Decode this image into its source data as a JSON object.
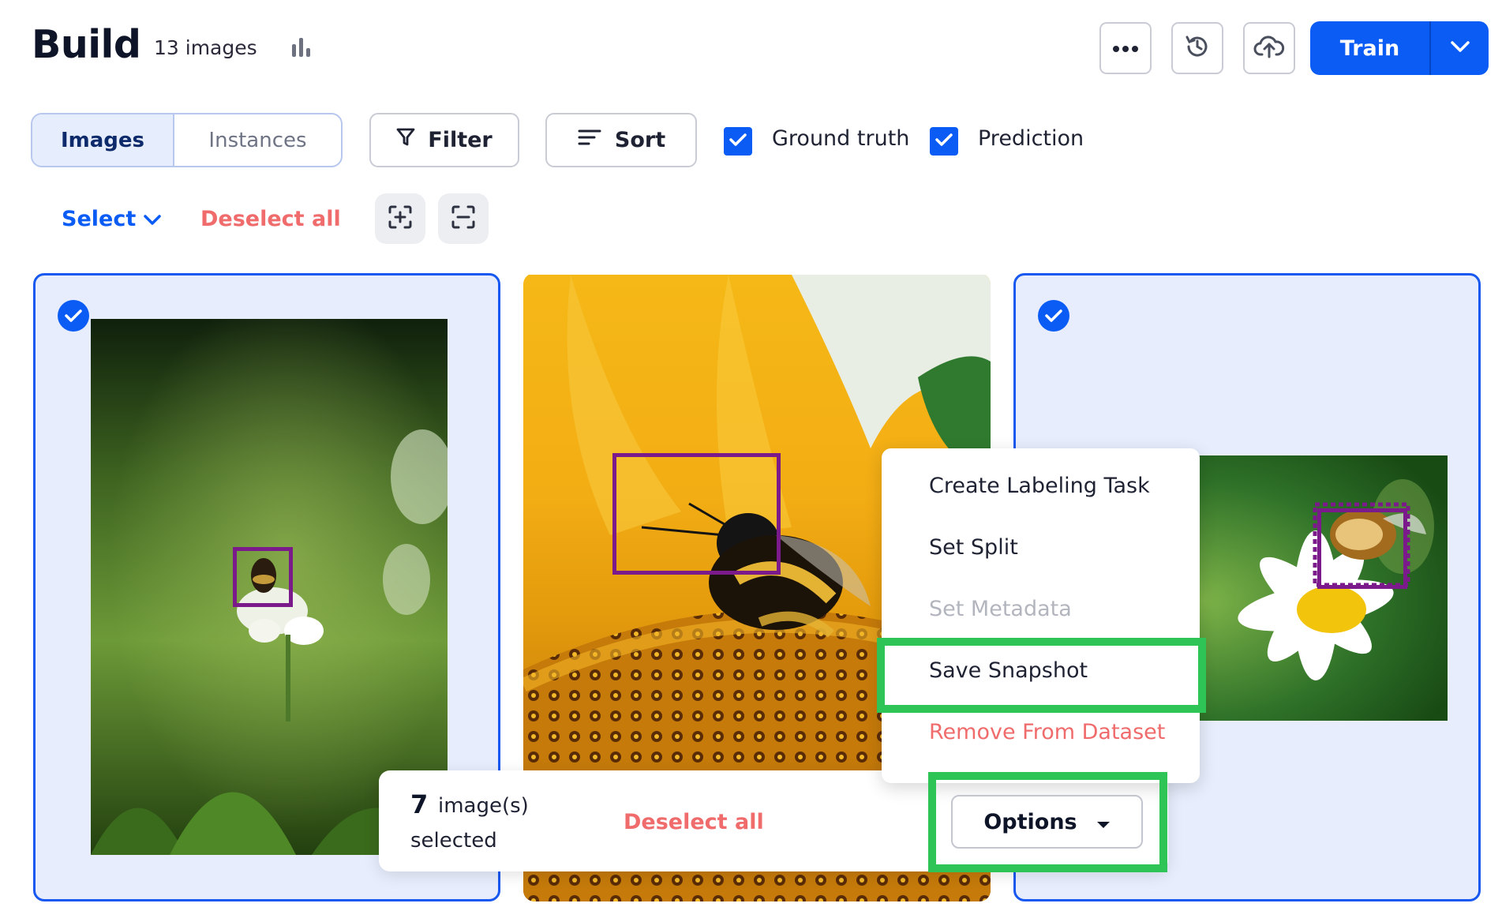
{
  "header": {
    "title": "Build",
    "image_count": "13 images",
    "train_label": "Train"
  },
  "toolbar": {
    "tabs": [
      {
        "label": "Images",
        "active": true
      },
      {
        "label": "Instances",
        "active": false
      }
    ],
    "filter_label": "Filter",
    "sort_label": "Sort",
    "ground_truth_label": "Ground truth",
    "ground_truth_checked": true,
    "prediction_label": "Prediction",
    "prediction_checked": true,
    "select_label": "Select",
    "deselect_all_label": "Deselect all"
  },
  "cards": [
    {
      "selected": true,
      "subject": "bee on clover"
    },
    {
      "selected": false,
      "subject": "bumblebee on sunflower"
    },
    {
      "selected": true,
      "subject": "bee on daisy"
    }
  ],
  "context_menu": {
    "items": [
      {
        "label": "Create Labeling Task",
        "state": "enabled"
      },
      {
        "label": "Set Split",
        "state": "enabled"
      },
      {
        "label": "Set Metadata",
        "state": "disabled"
      },
      {
        "label": "Save Snapshot",
        "state": "highlighted"
      },
      {
        "label": "Remove From Dataset",
        "state": "destructive"
      }
    ]
  },
  "selection_bar": {
    "count": "7",
    "count_suffix": "image(s)",
    "count_line2": "selected",
    "deselect_all_label": "Deselect all",
    "options_label": "Options"
  },
  "colors": {
    "primary": "#0a5cf5",
    "danger": "#f06b6b",
    "highlight": "#2fc456",
    "bbox": "#7b1a8a"
  }
}
